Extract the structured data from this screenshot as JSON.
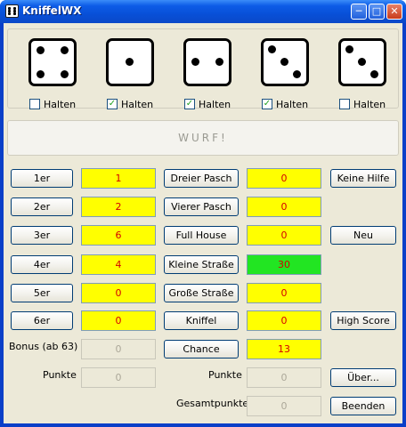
{
  "window": {
    "title": "KniffelWX",
    "min_icon": "minimize-icon",
    "max_icon": "maximize-icon",
    "close_icon": "close-icon"
  },
  "dice": [
    {
      "value": 4,
      "hold_label": "Halten",
      "held": false
    },
    {
      "value": 1,
      "hold_label": "Halten",
      "held": true
    },
    {
      "value": 2,
      "hold_label": "Halten",
      "held": true
    },
    {
      "value": 3,
      "hold_label": "Halten",
      "held": true
    },
    {
      "value": 3,
      "hold_label": "Halten",
      "held": false
    }
  ],
  "roll_button": {
    "label": "WURF!"
  },
  "upper": [
    {
      "label": "1er",
      "value": "1"
    },
    {
      "label": "2er",
      "value": "2"
    },
    {
      "label": "3er",
      "value": "6"
    },
    {
      "label": "4er",
      "value": "4"
    },
    {
      "label": "5er",
      "value": "0"
    },
    {
      "label": "6er",
      "value": "0"
    }
  ],
  "bonus": {
    "label": "Bonus (ab 63)",
    "value": "0"
  },
  "upper_points": {
    "label": "Punkte",
    "value": "0"
  },
  "lower": [
    {
      "label": "Dreier Pasch",
      "value": "0"
    },
    {
      "label": "Vierer Pasch",
      "value": "0"
    },
    {
      "label": "Full House",
      "value": "0"
    },
    {
      "label": "Kleine Straße",
      "value": "30"
    },
    {
      "label": "Große Straße",
      "value": "0"
    },
    {
      "label": "Kniffel",
      "value": "0"
    },
    {
      "label": "Chance",
      "value": "13"
    }
  ],
  "lower_points": {
    "label": "Punkte",
    "value": "0"
  },
  "total": {
    "label": "Gesamtpunkte",
    "value": "0"
  },
  "side_buttons": {
    "help": "Keine Hilfe",
    "new": "Neu",
    "highscore": "High Score",
    "about": "Über...",
    "quit": "Beenden"
  },
  "colors": {
    "filled": "#ffff00",
    "selected": "#22e522",
    "value_text": "#d40000"
  }
}
